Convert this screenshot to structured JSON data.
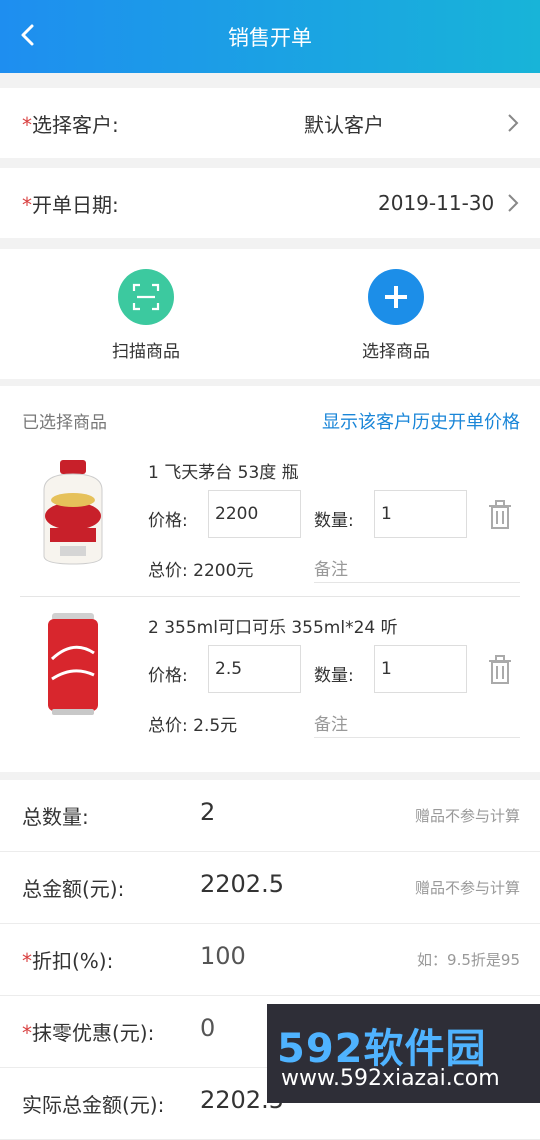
{
  "header": {
    "title": "销售开单"
  },
  "customer": {
    "required": "*",
    "label": "选择客户:",
    "value": "默认客户"
  },
  "date": {
    "required": "*",
    "label": "开单日期:",
    "value": "2019-11-30"
  },
  "actions": {
    "scan_label": "扫描商品",
    "select_label": "选择商品"
  },
  "selected": {
    "header": "已选择商品",
    "history_link": "显示该客户历史开单价格",
    "price_label": "价格:",
    "qty_label": "数量:",
    "note_placeholder": "备注",
    "items": [
      {
        "name": "1 飞天茅台 53度 瓶",
        "price": "2200",
        "qty": "1",
        "total": "总价: 2200元"
      },
      {
        "name": "2 355ml可口可乐 355ml*24 听",
        "price": "2.5",
        "qty": "1",
        "total": "总价: 2.5元"
      }
    ]
  },
  "summary": {
    "rows": [
      {
        "required": "",
        "label": "总数量:",
        "value": "2",
        "hint": "赠品不参与计算"
      },
      {
        "required": "",
        "label": "总金额(元):",
        "value": "2202.5",
        "hint": "赠品不参与计算"
      },
      {
        "required": "*",
        "label": "折扣(%):",
        "value": "100",
        "hint": "如：9.5折是95"
      },
      {
        "required": "*",
        "label": "抹零优惠(元):",
        "value": "0",
        "hint": ""
      },
      {
        "required": "",
        "label": "实际总金额(元):",
        "value": "2202.5",
        "hint": ""
      }
    ]
  },
  "watermark": {
    "brand": "592软件园",
    "url": "www.592xiazai.com"
  },
  "colors": {
    "header_start": "#1e8ef0",
    "header_end": "#18b4d8",
    "scan": "#3cc99f",
    "select": "#1c8ee8",
    "required": "#d84040",
    "link": "#1a86d8"
  }
}
